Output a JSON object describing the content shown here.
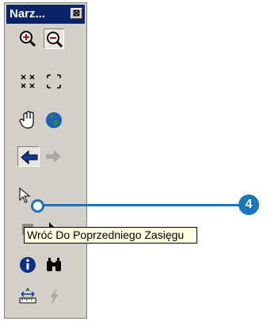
{
  "toolbar": {
    "title": "Narz...",
    "close_glyph": "⊠",
    "tools": [
      {
        "name": "zoom-in-tool",
        "icon": "zoom-in-icon"
      },
      {
        "name": "zoom-out-tool",
        "icon": "zoom-out-icon",
        "state": "pressed"
      },
      {
        "name": "fixed-zoom-in-tool",
        "icon": "fixed-zoom-in-icon"
      },
      {
        "name": "fixed-zoom-out-tool",
        "icon": "fixed-zoom-out-icon"
      },
      {
        "name": "pan-tool",
        "icon": "hand-icon"
      },
      {
        "name": "full-extent-tool",
        "icon": "globe-icon"
      },
      {
        "name": "go-back-tool",
        "icon": "back-arrow-icon"
      },
      {
        "name": "go-forward-tool",
        "icon": "forward-arrow-icon",
        "state": "disabled"
      },
      {
        "name": "select-features-tool",
        "icon": "select-features-icon"
      },
      {
        "name": "select-elements-tool",
        "icon": "pointer-arrow-icon"
      },
      {
        "name": "identify-tool",
        "icon": "info-icon"
      },
      {
        "name": "find-tool",
        "icon": "binoculars-icon"
      },
      {
        "name": "measure-tool",
        "icon": "measure-icon"
      },
      {
        "name": "hyperlink-tool",
        "icon": "lightning-icon",
        "state": "disabled"
      }
    ]
  },
  "tooltip": {
    "text": "Wróć Do Poprzedniego Zasięgu"
  },
  "callout": {
    "number": "4",
    "color": "#1b75bc"
  },
  "colors": {
    "title_bar": "#0a246a",
    "toolbar_bg": "#d4d0c8",
    "tooltip_bg": "#ffffe1",
    "callout": "#1b75bc"
  }
}
